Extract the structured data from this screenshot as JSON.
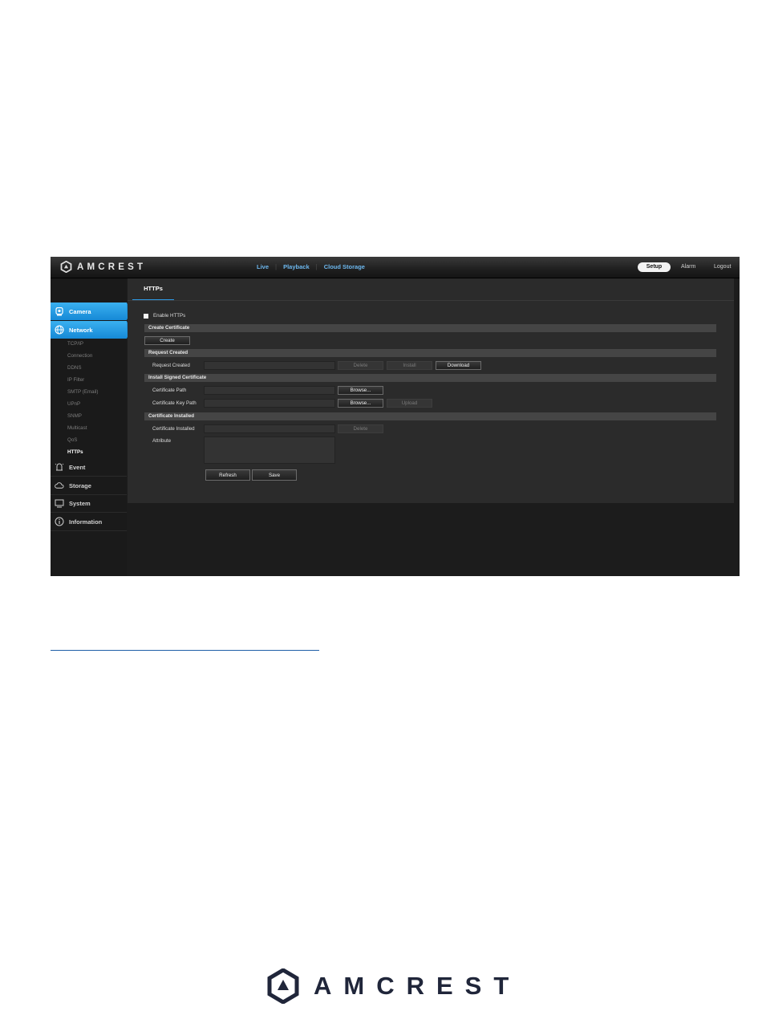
{
  "brand": {
    "name": "AMCREST"
  },
  "topnav": {
    "items": [
      {
        "label": "Live"
      },
      {
        "label": "Playback"
      },
      {
        "label": "Cloud Storage"
      }
    ],
    "setup_label": "Setup",
    "alarm_label": "Alarm",
    "logout_label": "Logout"
  },
  "sidebar": {
    "camera": "Camera",
    "network": "Network",
    "network_sub": [
      "TCP/IP",
      "Connection",
      "DDNS",
      "IP Filter",
      "SMTP (Email)",
      "UPnP",
      "SNMP",
      "Multicast",
      "QoS",
      "HTTPs"
    ],
    "event": "Event",
    "storage": "Storage",
    "system": "System",
    "information": "Information"
  },
  "tab": {
    "label": "HTTPs"
  },
  "form": {
    "enable_label": "Enable HTTPs",
    "create_section": "Create Certificate",
    "create_button": "Create",
    "request_section": "Request Created",
    "request_label": "Request Created",
    "delete_button": "Delete",
    "install_button": "Install",
    "download_button": "Download",
    "install_section": "Install Signed Certificate",
    "cert_path_label": "Certificate Path",
    "cert_key_path_label": "Certificate Key Path",
    "browse_button": "Browse...",
    "upload_button": "Upload",
    "installed_section": "Certificate Installed",
    "installed_label": "Certificate Installed",
    "installed_delete_button": "Delete",
    "attribute_label": "Attribute",
    "refresh_button": "Refresh",
    "save_button": "Save"
  },
  "colors": {
    "accent": "#1e92dc",
    "nav_link": "#6db8ef",
    "footer_brand": "#20263a"
  }
}
